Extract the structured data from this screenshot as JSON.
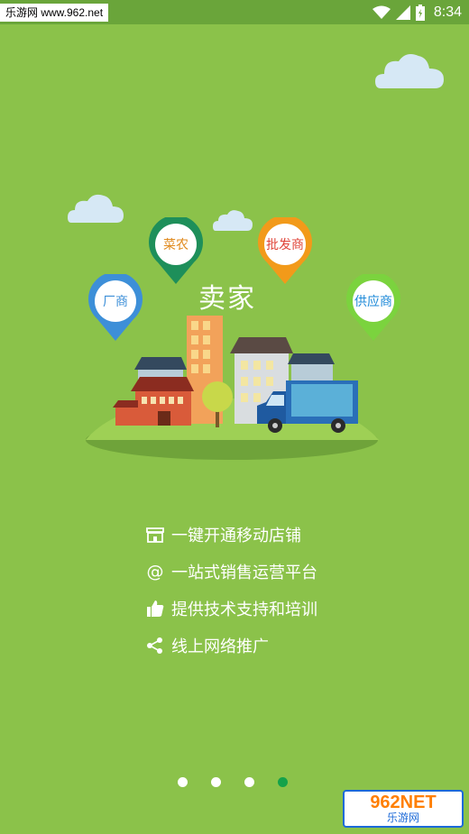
{
  "status_bar": {
    "watermark": "乐游网 www.962.net",
    "time": "8:34",
    "icons": [
      "wifi-icon",
      "signal-icon",
      "battery-icon"
    ]
  },
  "illustration": {
    "title": "卖家",
    "pins": [
      {
        "label": "厂商",
        "color": "#3d8fd8",
        "text_color": "#3d8fd8"
      },
      {
        "label": "菜农",
        "color": "#1e8f5a",
        "text_color": "#e08a1e"
      },
      {
        "label": "批发商",
        "color": "#f29a1a",
        "text_color": "#e0453a"
      },
      {
        "label": "供应商",
        "color": "#7bd33e",
        "text_color": "#1e8ad8"
      }
    ]
  },
  "features": [
    {
      "icon": "store-icon",
      "text": "一键开通移动店铺"
    },
    {
      "icon": "at-icon",
      "text": "一站式销售运营平台"
    },
    {
      "icon": "thumbs-up-icon",
      "text": "提供技术支持和培训"
    },
    {
      "icon": "share-icon",
      "text": "线上网络推广"
    }
  ],
  "pager": {
    "count": 4,
    "active_index": 3
  },
  "bottom_watermark": {
    "line1": "962NET",
    "line2": "乐游网"
  },
  "colors": {
    "background": "#8bc24a",
    "active_dot": "#15a24a"
  }
}
